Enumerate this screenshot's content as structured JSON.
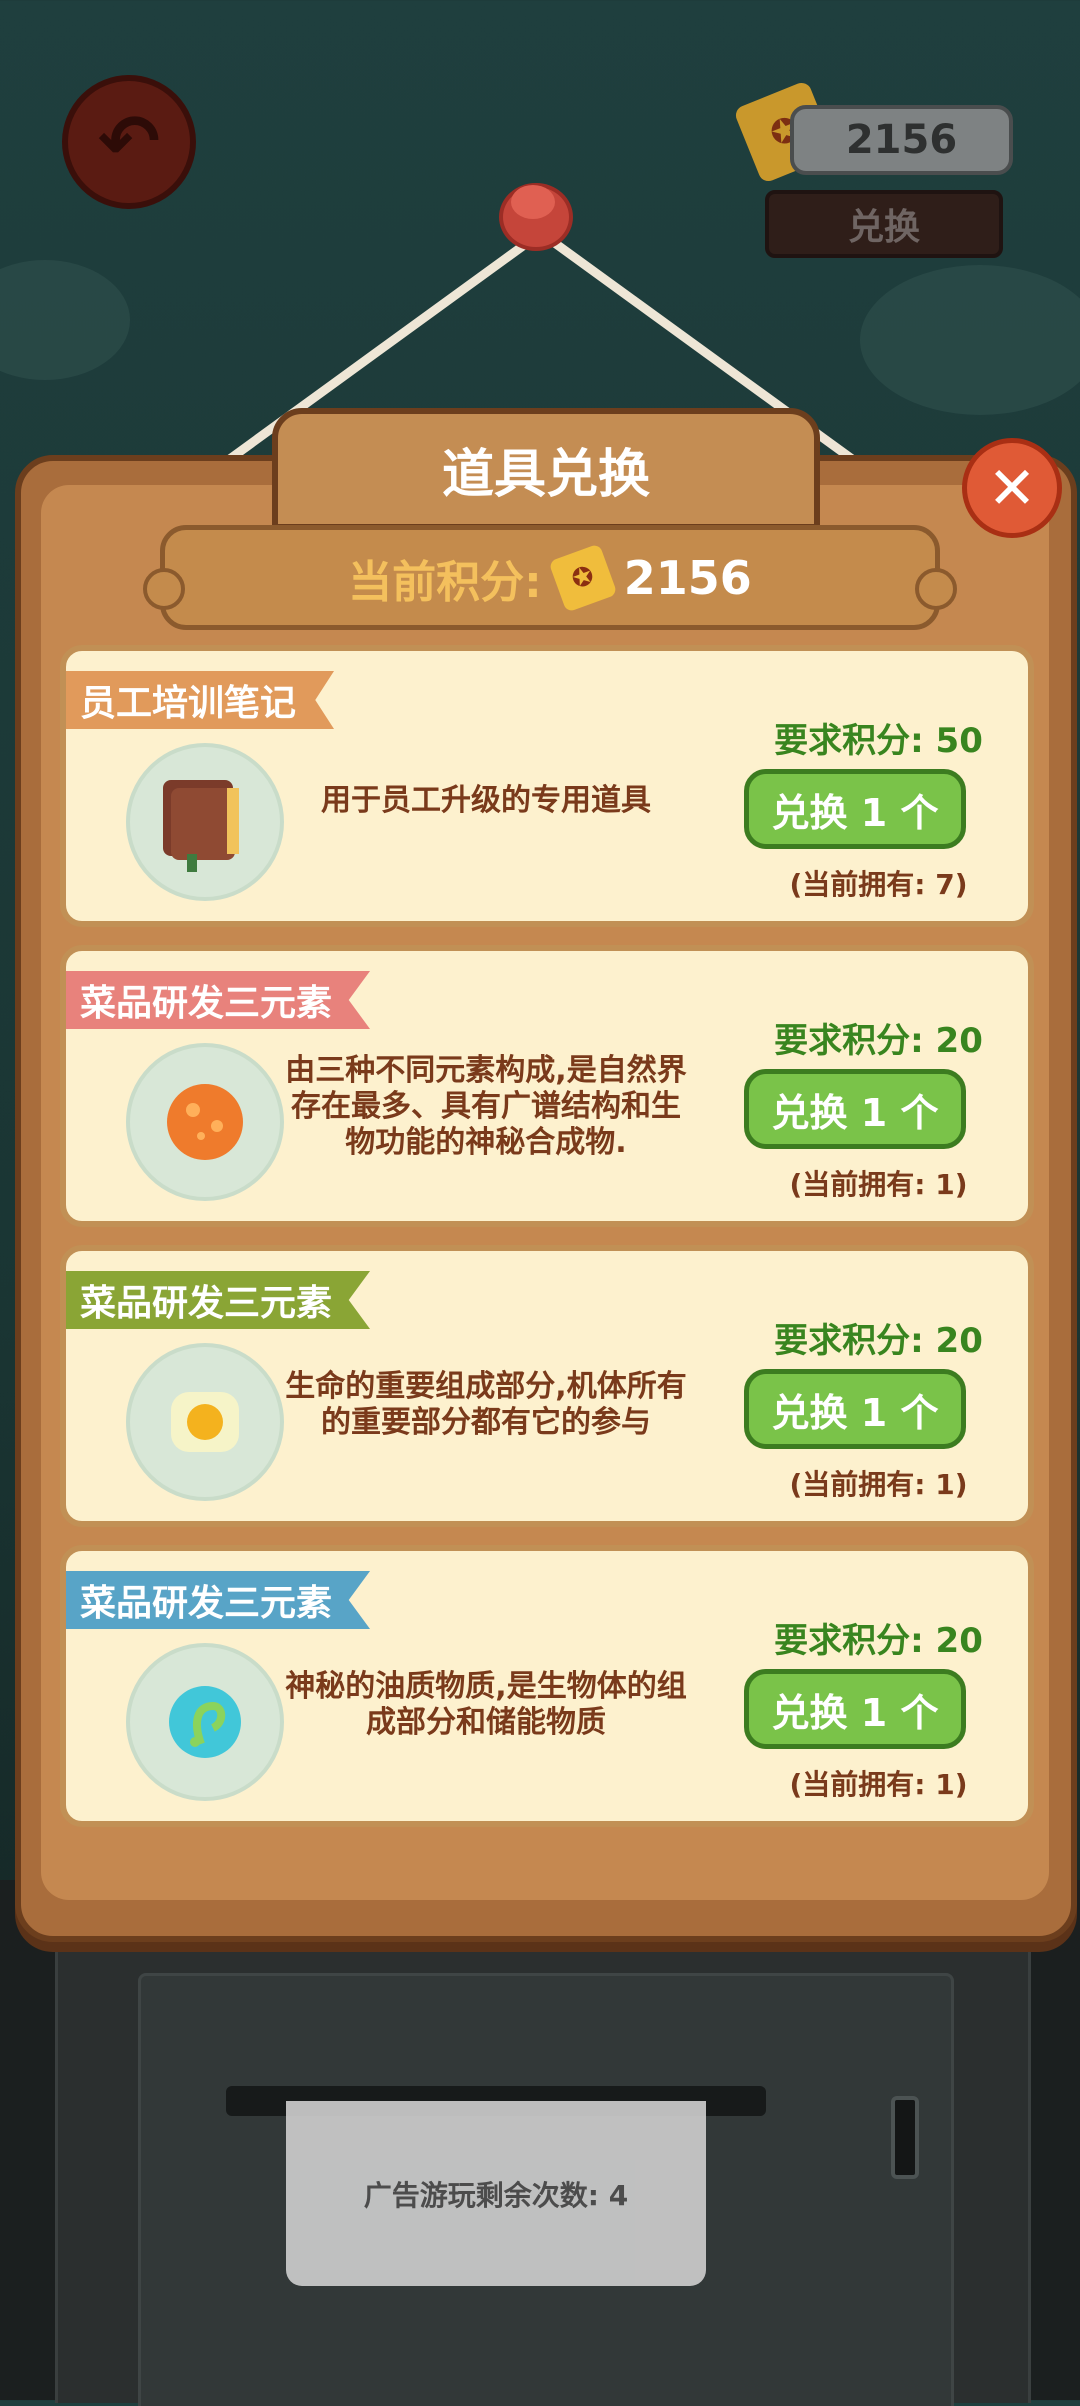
{
  "top": {
    "score": "2156",
    "exchange_label": "兑换"
  },
  "modal": {
    "title": "道具兑换",
    "score_label": "当前积分:",
    "score_value": "2156"
  },
  "items": [
    {
      "title": "员工培训笔记",
      "desc": "用于员工升级的专用道具",
      "requirement": "要求积分: 50",
      "button": "兑换 1 个",
      "owned": "(当前拥有: 7)",
      "icon": "book-icon",
      "ribbon_color": "#e19a5b"
    },
    {
      "title": "菜品研发三元素",
      "desc": "由三种不同元素构成,是自然界存在最多、具有广谱结构和生物功能的神秘合成物.",
      "requirement": "要求积分: 20",
      "button": "兑换 1 个",
      "owned": "(当前拥有: 1)",
      "icon": "orange-element-icon",
      "ribbon_color": "#e8827c"
    },
    {
      "title": "菜品研发三元素",
      "desc": "生命的重要组成部分,机体所有的重要部分都有它的参与",
      "requirement": "要求积分: 20",
      "button": "兑换 1 个",
      "owned": "(当前拥有: 1)",
      "icon": "egg-element-icon",
      "ribbon_color": "#8aa535"
    },
    {
      "title": "菜品研发三元素",
      "desc": "神秘的油质物质,是生物体的组成部分和储能物质",
      "requirement": "要求积分: 20",
      "button": "兑换 1 个",
      "owned": "(当前拥有: 1)",
      "icon": "water-element-icon",
      "ribbon_color": "#58a4c7"
    }
  ],
  "ad": {
    "remaining": "广告游玩剩余次数: 4"
  },
  "colors": {
    "accent": "#7ac349",
    "wood": "#c58850",
    "panel": "#fdf1ce"
  }
}
